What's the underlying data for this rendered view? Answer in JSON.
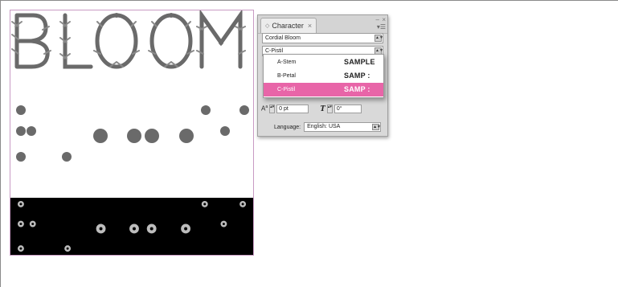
{
  "artwork": {
    "title_text": "BLOOM"
  },
  "character_panel": {
    "tab_label": "Character",
    "tab_close": "×",
    "minimize": "–",
    "close": "×",
    "menu_icon": "panel-menu-icon",
    "font_family": "Cordial Bloom",
    "font_style": "C-Pistil",
    "tracking_value": "0 pt",
    "skew_value": "0°",
    "language_label": "Language:",
    "language_value": "English: USA"
  },
  "style_dropdown": {
    "items": [
      {
        "label": "A-Stem",
        "sample": "SAMPLE",
        "selected": false
      },
      {
        "label": "B-Petal",
        "sample": "SAMP :",
        "selected": false
      },
      {
        "label": "C-Pistil",
        "sample": "SAMP :",
        "selected": true
      }
    ],
    "selected_color": "#e865a8"
  },
  "colors": {
    "ink": "#666666",
    "artboard_border": "#c99bc4",
    "band": "#000000"
  }
}
